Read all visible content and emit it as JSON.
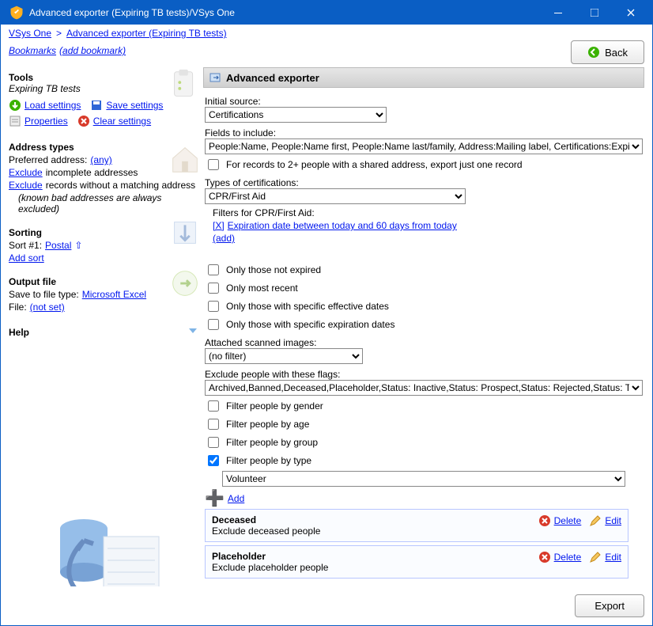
{
  "window": {
    "title": "Advanced exporter (Expiring TB tests)/VSys One"
  },
  "breadcrumb": {
    "root": "VSys One",
    "current": "Advanced exporter (Expiring TB tests)"
  },
  "bookmarks": {
    "label": "Bookmarks",
    "add": "(add bookmark)"
  },
  "back_label": "Back",
  "sidebar": {
    "tools": {
      "head": "Tools",
      "subtitle": "Expiring TB tests",
      "load": "Load settings",
      "save": "Save settings",
      "properties": "Properties",
      "clear": "Clear settings"
    },
    "address": {
      "head": "Address types",
      "pref_label": "Preferred address:",
      "pref_value": "(any)",
      "exclude1a": "Exclude",
      "exclude1b": " incomplete addresses",
      "exclude2a": "Exclude",
      "exclude2b": " records without a matching address",
      "note": "(known bad addresses are always excluded)"
    },
    "sorting": {
      "head": "Sorting",
      "sort1_label": "Sort #1:",
      "sort1_value": "Postal",
      "add": "Add sort"
    },
    "output": {
      "head": "Output file",
      "type_label": "Save to file type: ",
      "type_value": "Microsoft Excel",
      "file_label": "File: ",
      "file_value": "(not set)"
    },
    "help": "Help"
  },
  "panel": {
    "title": "Advanced exporter",
    "initial_source_label": "Initial source:",
    "initial_source_value": "Certifications",
    "fields_label": "Fields to include:",
    "fields_value": "People:Name, People:Name first, People:Name last/family, Address:Mailing label, Certifications:Expiration date",
    "shared_addr": "For records to 2+ people with a shared address, export just one record",
    "types_label": "Types of certifications:",
    "types_value": "CPR/First Aid",
    "filters_header": "Filters for CPR/First Aid:",
    "filter_x": "[X]",
    "filter_text": "Expiration date between today and 60 days from today",
    "filter_add": "(add)",
    "only_not_expired": "Only those not expired",
    "only_most_recent": "Only most recent",
    "only_eff": "Only those with specific effective dates",
    "only_exp": "Only those with specific expiration dates",
    "attached_label": "Attached scanned images:",
    "attached_value": "(no filter)",
    "exclude_flags_label": "Exclude people with these flags:",
    "exclude_flags_value": "Archived,Banned,Deceased,Placeholder,Status: Inactive,Status: Prospect,Status: Rejected,Status: Termina",
    "filter_gender": "Filter people by gender",
    "filter_age": "Filter people by age",
    "filter_group": "Filter people by group",
    "filter_type": "Filter people by type",
    "type_value": "Volunteer",
    "add": "Add",
    "rules": [
      {
        "title": "Deceased",
        "desc": "Exclude deceased people"
      },
      {
        "title": "Placeholder",
        "desc": "Exclude placeholder people"
      }
    ],
    "delete": "Delete",
    "edit": "Edit"
  },
  "footer": {
    "export": "Export"
  }
}
